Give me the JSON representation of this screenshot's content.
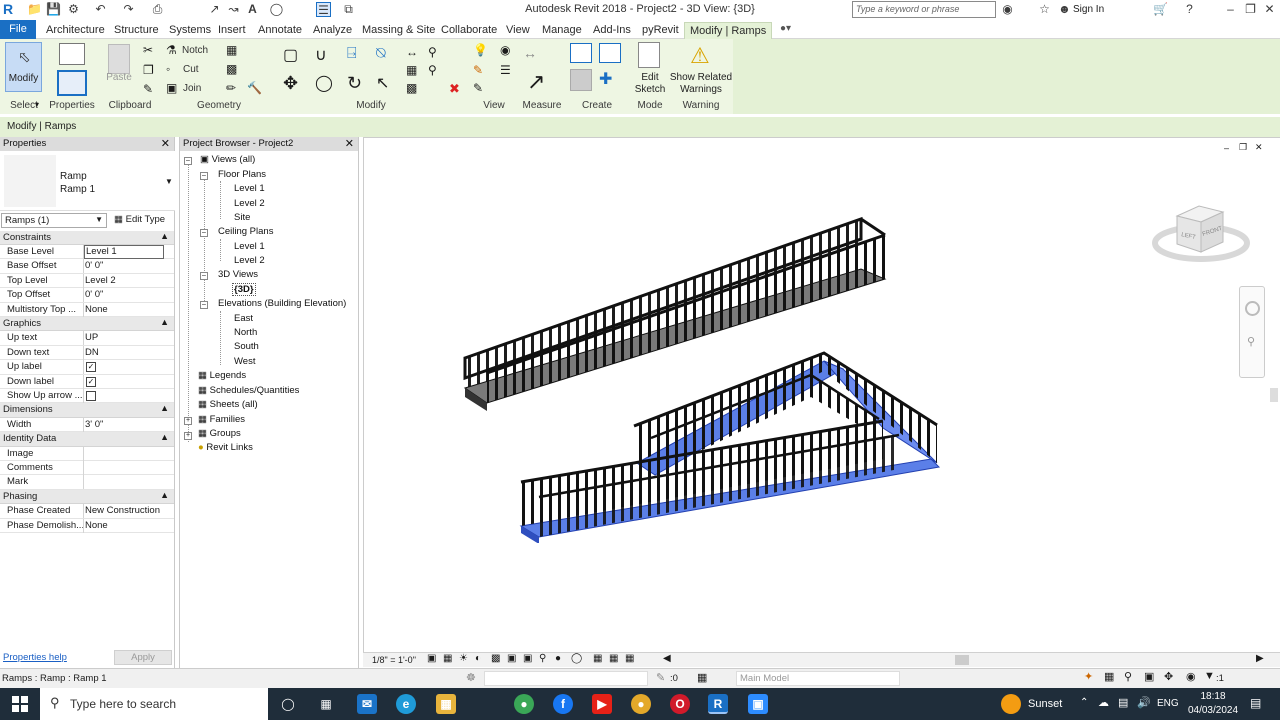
{
  "titlebar": {
    "app_logo": "R",
    "title": "Autodesk Revit 2018 -    Project2 - 3D View: {3D}",
    "search_placeholder": "Type a keyword or phrase",
    "sign_in": "Sign In"
  },
  "tabs": {
    "file": "File",
    "items": [
      "Architecture",
      "Structure",
      "Systems",
      "Insert",
      "Annotate",
      "Analyze",
      "Massing & Site",
      "Collaborate",
      "View",
      "Manage",
      "Add-Ins",
      "pyRevit",
      "Modify | Ramps"
    ]
  },
  "ribbon": {
    "select_label": "Modify",
    "select_group": "Select",
    "properties_group": "Properties",
    "paste_label": "Paste",
    "clipboard_group": "Clipboard",
    "notch_label": "Notch",
    "cut_label": "Cut",
    "join_label": "Join",
    "geometry_group": "Geometry",
    "modify_group": "Modify",
    "view_group": "View",
    "measure_group": "Measure",
    "create_group": "Create",
    "edit_sketch_label": "Edit\nSketch",
    "edit_sketch_l1": "Edit",
    "edit_sketch_l2": "Sketch",
    "mode_group": "Mode",
    "show_warnings_l1": "Show Related",
    "show_warnings_l2": "Warnings",
    "warning_group": "Warning"
  },
  "context_bar": "Modify | Ramps",
  "properties": {
    "title": "Properties",
    "type_family": "Ramp",
    "type_name": "Ramp 1",
    "selector": "Ramps (1)",
    "edit_type": "Edit Type",
    "sections": {
      "constraints": "Constraints",
      "graphics": "Graphics",
      "dimensions": "Dimensions",
      "identity": "Identity Data",
      "phasing": "Phasing"
    },
    "rows": {
      "base_level": [
        "Base Level",
        "Level 1"
      ],
      "base_offset": [
        "Base Offset",
        "0'  0\""
      ],
      "top_level": [
        "Top Level",
        "Level 2"
      ],
      "top_offset": [
        "Top Offset",
        "0'  0\""
      ],
      "multistory": [
        "Multistory Top ...",
        "None"
      ],
      "up_text": [
        "Up text",
        "UP"
      ],
      "down_text": [
        "Down text",
        "DN"
      ],
      "up_label": [
        "Up label",
        ""
      ],
      "down_label": [
        "Down label",
        ""
      ],
      "show_up_arrow": [
        "Show Up arrow ...",
        ""
      ],
      "width": [
        "Width",
        "3'  0\""
      ],
      "image": [
        "Image",
        ""
      ],
      "comments": [
        "Comments",
        ""
      ],
      "mark": [
        "Mark",
        ""
      ],
      "phase_created": [
        "Phase Created",
        "New Construction"
      ],
      "phase_demolished": [
        "Phase Demolish...",
        "None"
      ]
    },
    "help_link": "Properties help",
    "apply": "Apply"
  },
  "browser": {
    "title": "Project Browser - Project2",
    "views_all": "Views (all)",
    "floor_plans": "Floor Plans",
    "fp_level1": "Level 1",
    "fp_level2": "Level 2",
    "fp_site": "Site",
    "ceiling_plans": "Ceiling Plans",
    "cp_level1": "Level 1",
    "cp_level2": "Level 2",
    "views_3d": "3D Views",
    "view_3d": "{3D}",
    "elevations": "Elevations (Building Elevation)",
    "east": "East",
    "north": "North",
    "south": "South",
    "west": "West",
    "legends": "Legends",
    "schedules": "Schedules/Quantities",
    "sheets": "Sheets (all)",
    "families": "Families",
    "groups": "Groups",
    "revit_links": "Revit Links"
  },
  "viewcube": {
    "face_left": "LEFT",
    "face_front": "FRONT"
  },
  "viewbar": {
    "scale": "1/8\" = 1'-0\""
  },
  "statusbar": {
    "text": "Ramps : Ramp : Ramp 1",
    "sel_count": ":0",
    "model": "Main Model",
    "filter_count": ":1"
  },
  "taskbar": {
    "search_placeholder": "Type here to search",
    "weather": "Sunset",
    "lang": "ENG",
    "time": "18:18",
    "date": "04/03/2024"
  },
  "colors": {
    "file_tab": "#1a6fc4",
    "ribbon_green": "#e4f1d5",
    "selected_ramp": "#5b7fe8",
    "taskbar": "#1f2d3a"
  }
}
